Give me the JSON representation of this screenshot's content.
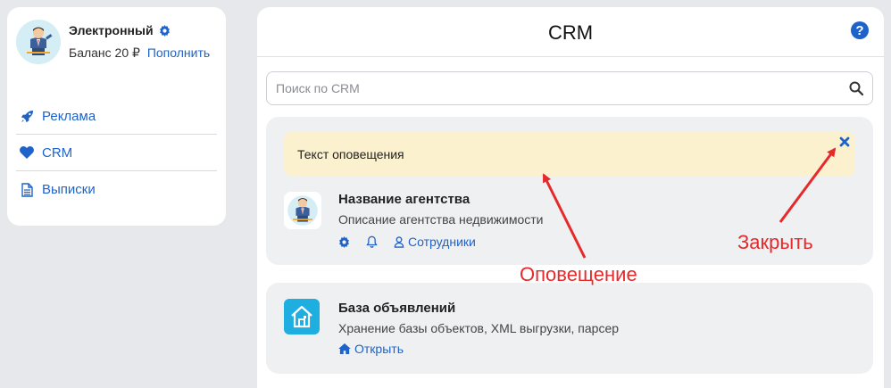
{
  "profile": {
    "name": "Электронный",
    "balance_label": "Баланс 20 ₽",
    "topup_link": "Пополнить"
  },
  "menu": [
    {
      "label": "Реклама",
      "icon": "rocket-icon"
    },
    {
      "label": "CRM",
      "icon": "heart-icon"
    },
    {
      "label": "Выписки",
      "icon": "document-icon"
    }
  ],
  "header": {
    "title": "CRM",
    "help_icon": "question-icon"
  },
  "search": {
    "placeholder": "Поиск по CRM",
    "value": ""
  },
  "notification": {
    "text": "Текст оповещения"
  },
  "agency": {
    "name": "Название агентства",
    "description": "Описание агентства недвижимости",
    "employees_link": "Сотрудники"
  },
  "database": {
    "name": "База объявлений",
    "description": "Хранение базы объектов, XML выгрузки, парсер",
    "open_link": "Открыть"
  },
  "annotations": {
    "notification_label": "Оповещение",
    "close_label": "Закрыть"
  },
  "colors": {
    "accent": "#1e63c9",
    "annotation": "#e6292b",
    "notice_bg": "#fcf1cf",
    "db_logo": "#1eaee0"
  }
}
